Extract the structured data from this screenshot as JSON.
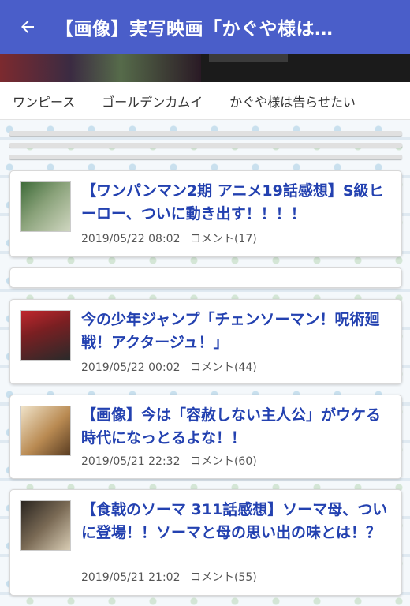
{
  "appbar": {
    "title": "【画像】実写映画「かぐや様は…",
    "back_icon": "arrow-left-icon"
  },
  "tabs": [
    "ワンピース",
    "ゴールデンカムイ",
    "かぐや様は告らせたい"
  ],
  "articles": [
    {
      "title": "【ワンパンマン2期 アニメ19話感想】S級ヒーロー、ついに動き出す！！！！",
      "date": "2019/05/22 08:02",
      "comments": "コメント(17)",
      "thumb_colors": [
        "#3f6b3a",
        "#cfd6c0"
      ]
    },
    {
      "title": "今の少年ジャンプ「チェンソーマン！呪術廻戦！アクタージュ！」",
      "date": "2019/05/22 00:02",
      "comments": "コメント(44)",
      "thumb_colors": [
        "#c0272d",
        "#2a2a2a"
      ]
    },
    {
      "title": "【画像】今は「容赦しない主人公」がウケる時代になっとるよな！！",
      "date": "2019/05/21 22:32",
      "comments": "コメント(60)",
      "thumb_colors": [
        "#b98a52",
        "#efe2c8"
      ]
    },
    {
      "title": "【食戟のソーマ 311話感想】ソーマ母、ついに登場！！ソーマと母の思い出の味とは！？",
      "date": "2019/05/21 21:02",
      "comments": "コメント(55)",
      "thumb_colors": [
        "#7a6a55",
        "#2a2520"
      ]
    }
  ],
  "colors": {
    "appbar": "#4a5ec9",
    "title_link": "#2341b0"
  }
}
